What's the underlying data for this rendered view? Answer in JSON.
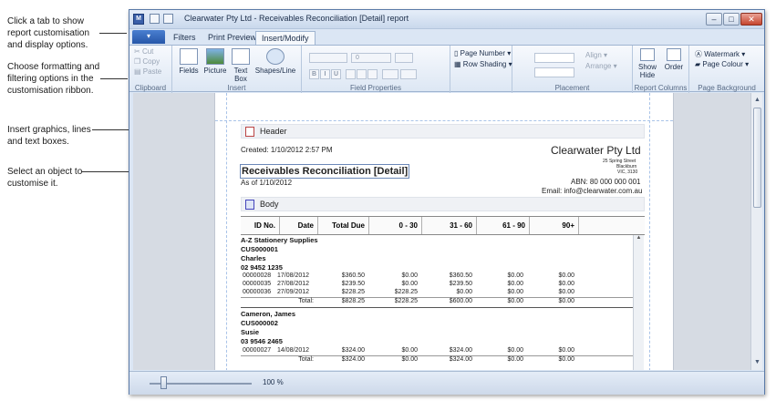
{
  "callouts": {
    "tabs": "Click a tab to show report customisation and display options.",
    "ribbon": "Choose formatting and filtering options in the customisation ribbon.",
    "insert": "Insert graphics, lines and text boxes.",
    "select": "Select an object to customise it."
  },
  "window": {
    "title": "Clearwater Pty Ltd - Receivables Reconciliation [Detail] report",
    "min_glyph": "–",
    "max_glyph": "□",
    "close_glyph": "✕"
  },
  "tabs": {
    "file": "▾",
    "filters": "Filters",
    "print_preview": "Print Preview",
    "insert_modify": "Insert/Modify"
  },
  "ribbon": {
    "clipboard": {
      "cut": "Cut",
      "copy": "Copy",
      "paste": "Paste",
      "label": "Clipboard"
    },
    "insert": {
      "fields": "Fields",
      "picture": "Picture",
      "text_box": "Text Box",
      "shapes_line": "Shapes/Line",
      "label": "Insert"
    },
    "field_properties": {
      "font_size": "0",
      "bold": "B",
      "italic": "I",
      "underline": "U",
      "label": "Field Properties"
    },
    "page": {
      "page_number": "Page Number ▾",
      "row_shading": "Row Shading ▾"
    },
    "placement": {
      "align": "Align ▾",
      "arrange": "Arrange ▾",
      "label": "Placement"
    },
    "report_columns": {
      "show_hide": "Show Hide",
      "order": "Order",
      "label": "Report Columns"
    },
    "page_background": {
      "watermark": "Watermark ▾",
      "page_colour": "Page Colour ▾",
      "label": "Page Background"
    }
  },
  "report": {
    "header_section": "Header",
    "created": "Created: 1/10/2012 2:57 PM",
    "title": "Receivables Reconciliation [Detail]",
    "as_of": "As of 1/10/2012",
    "company_name": "Clearwater Pty Ltd",
    "address_1": "25 Spring Street",
    "address_2": "Blackburn",
    "address_3": "VIC, 3130",
    "abn": "ABN: 80 000 000 001",
    "email": "Email: info@clearwater.com.au",
    "body_section": "Body",
    "columns": [
      "ID No.",
      "Date",
      "Total Due",
      "0 - 30",
      "31 - 60",
      "61 - 90",
      "90+"
    ],
    "customers": [
      {
        "name": "A-Z Stationery Supplies",
        "code": "CUS000001",
        "contact": "Charles",
        "phone": "02 9452 1235",
        "rows": [
          [
            "00000028",
            "17/08/2012",
            "$360.50",
            "$0.00",
            "$360.50",
            "$0.00",
            "$0.00"
          ],
          [
            "00000035",
            "27/08/2012",
            "$239.50",
            "$0.00",
            "$239.50",
            "$0.00",
            "$0.00"
          ],
          [
            "00000036",
            "27/09/2012",
            "$228.25",
            "$228.25",
            "$0.00",
            "$0.00",
            "$0.00"
          ]
        ],
        "total": [
          "Total:",
          "$828.25",
          "$228.25",
          "$600.00",
          "$0.00",
          "$0.00"
        ]
      },
      {
        "name": "Cameron, James",
        "code": "CUS000002",
        "contact": "Susie",
        "phone": "03 9546 2465",
        "rows": [
          [
            "00000027",
            "14/08/2012",
            "$324.00",
            "$0.00",
            "$324.00",
            "$0.00",
            "$0.00"
          ]
        ],
        "total": [
          "Total:",
          "$324.00",
          "$0.00",
          "$324.00",
          "$0.00",
          "$0.00"
        ]
      }
    ]
  },
  "status": {
    "zoom": "100 %"
  },
  "colors": {
    "accent": "#2656a8",
    "ribbon": "#dde7f4",
    "workspace": "#d6dbe3"
  }
}
